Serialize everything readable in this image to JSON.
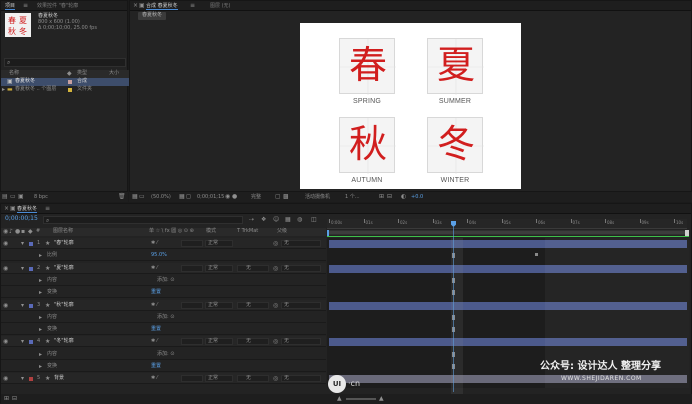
{
  "project_panel": {
    "tabs": [
      "项目",
      "效果控件 \"春\"轮廓"
    ],
    "preview_name": "春夏秋冬",
    "preview_info": [
      "800 x 600 (1.00)",
      "Δ 0;00;10;00, 25.00 fps"
    ],
    "search_placeholder": "",
    "columns": {
      "name": "名称",
      "type": "类型",
      "size": "大小"
    },
    "items": [
      {
        "name": "春夏秋冬",
        "type": "合成",
        "color": "#c8a0a0",
        "selected": true
      },
      {
        "name": "春夏秋冬 .. 个图层",
        "type": "文件夹",
        "color": "#d4b43c"
      }
    ],
    "footer": "8 bpc"
  },
  "composition_panel": {
    "tabs": [
      "合成 春夏秋冬",
      "图层 (无)"
    ],
    "breadcrumb": "春夏秋冬",
    "footer": {
      "zoom": "(50.0%)",
      "timecode": "0;00;01;15",
      "quality": "完整",
      "camera": "活动摄像机",
      "views": "1 个...",
      "offset": "+0.0"
    }
  },
  "artwork": {
    "seasons": [
      {
        "char": "春",
        "label": "SPRING"
      },
      {
        "char": "夏",
        "label": "SUMMER"
      },
      {
        "char": "秋",
        "label": "AUTUMN"
      },
      {
        "char": "冬",
        "label": "WINTER"
      }
    ]
  },
  "timeline": {
    "tab": "春夏秋冬",
    "timecode": "0;00:00;15",
    "search_placeholder": "",
    "columns": {
      "num": "#",
      "name": "图层名称",
      "switches": "单 ☆ \\ fx 圆 ◎ ⊙ ⊛",
      "mode": "模式",
      "trkmat": "T TrkMat",
      "parent": "父级"
    },
    "layers": [
      {
        "num": "1",
        "name": "\"春\"轮廓",
        "color": "#5a6ab8",
        "mode": "正常",
        "trkmat": "",
        "parent": "无"
      },
      {
        "num": "",
        "name": "比例",
        "sub": true,
        "value": "95.0%",
        "parent": ""
      },
      {
        "num": "2",
        "name": "\"夏\"轮廓",
        "color": "#5a6ab8",
        "mode": "正常",
        "trkmat": "无",
        "parent": "无"
      },
      {
        "num": "",
        "name": "内容",
        "sub": true,
        "value": "添加: ⊙",
        "parent": ""
      },
      {
        "num": "",
        "name": "变换",
        "sub": true,
        "value": "重置",
        "parent": ""
      },
      {
        "num": "3",
        "name": "\"秋\"轮廓",
        "color": "#5a6ab8",
        "mode": "正常",
        "trkmat": "无",
        "parent": "无"
      },
      {
        "num": "",
        "name": "内容",
        "sub": true,
        "value": "添加: ⊙",
        "parent": ""
      },
      {
        "num": "",
        "name": "变换",
        "sub": true,
        "value": "重置",
        "parent": ""
      },
      {
        "num": "4",
        "name": "\"冬\"轮廓",
        "color": "#5a6ab8",
        "mode": "正常",
        "trkmat": "无",
        "parent": "无"
      },
      {
        "num": "",
        "name": "内容",
        "sub": true,
        "value": "添加: ⊙",
        "parent": ""
      },
      {
        "num": "",
        "name": "变换",
        "sub": true,
        "value": "重置",
        "parent": ""
      },
      {
        "num": "5",
        "name": "背景",
        "color": "#b04040",
        "mode": "正常",
        "trkmat": "无",
        "parent": "无"
      }
    ],
    "ruler_labels": [
      "0:00s",
      "01s",
      "02s",
      "03s",
      "04s",
      "05s",
      "06s",
      "07s",
      "08s",
      "09s",
      "10s"
    ]
  },
  "watermark": {
    "left_logo": "UI",
    "left_text": "·cn",
    "brand": "公众号: 设计达人 整理分享",
    "url": "WWW.SHEJIDAREN.COM"
  }
}
